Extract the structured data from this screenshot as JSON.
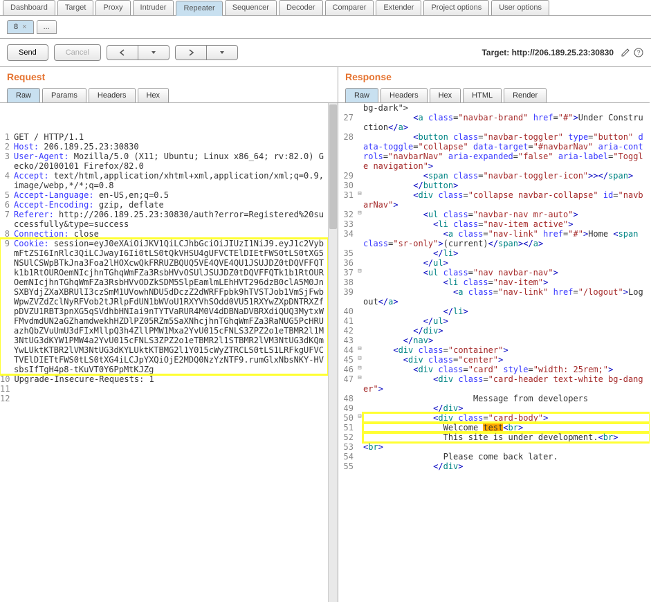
{
  "main_tabs": [
    {
      "label": "Dashboard",
      "active": false
    },
    {
      "label": "Target",
      "active": false
    },
    {
      "label": "Proxy",
      "active": false
    },
    {
      "label": "Intruder",
      "active": false
    },
    {
      "label": "Repeater",
      "active": true
    },
    {
      "label": "Sequencer",
      "active": false
    },
    {
      "label": "Decoder",
      "active": false
    },
    {
      "label": "Comparer",
      "active": false
    },
    {
      "label": "Extender",
      "active": false
    },
    {
      "label": "Project options",
      "active": false
    },
    {
      "label": "User options",
      "active": false
    }
  ],
  "sub_tabs": [
    {
      "label": "8",
      "active": true
    },
    {
      "label": "...",
      "active": false
    }
  ],
  "controls": {
    "send": "Send",
    "cancel": "Cancel",
    "target_label": "Target: http://206.189.25.23:30830"
  },
  "request": {
    "title": "Request",
    "view_tabs": [
      "Raw",
      "Params",
      "Headers",
      "Hex"
    ],
    "active_view": 0,
    "lines": [
      {
        "n": "1",
        "t": "GET / HTTP/1.1"
      },
      {
        "n": "2",
        "t": "Host",
        "v": " 206.189.25.23:30830"
      },
      {
        "n": "3",
        "t": "User-Agent",
        "v": " Mozilla/5.0 (X11; Ubuntu; Linux x86_64; rv:82.0) Gecko/20100101 Firefox/82.0"
      },
      {
        "n": "4",
        "t": "Accept",
        "v": " text/html,application/xhtml+xml,application/xml;q=0.9,image/webp,*/*;q=0.8"
      },
      {
        "n": "5",
        "t": "Accept-Language",
        "v": " en-US,en;q=0.5"
      },
      {
        "n": "6",
        "t": "Accept-Encoding",
        "v": " gzip, deflate"
      },
      {
        "n": "7",
        "t": "Referer",
        "v": " http://206.189.25.23:30830/auth?error=Registered%20successfully&type=success"
      },
      {
        "n": "8",
        "t": "Connection",
        "v": " close"
      },
      {
        "n": "9",
        "t": "Cookie",
        "v": " session=eyJ0eXAiOiJKV1QiLCJhbGciOiJIUzI1NiJ9.eyJ1c2VybmFtZSI6InRlc3QiLCJwayI6Ii0tLS0tQkVHSU4gUFVCTElDIEtFWS0tLS0tXG5NSUlCSWpBTkJna3Foa2lHOXcwQkFRRUZBQUQ5VE4QVE4QU1JSUJDZ0tDQVFFQTk1b1RtOUROemNIcjhnTGhqWmFZa3RsbHVvOSUlJSUJDZ0tDQVFFQTk1b1RtOUROemNIcjhnTGhqWmFZa3RsbHVvODZkSDM5SlpEamlmLEhHVT296dzB0clA5M0JnSXBYdjZXaXBRUlI3czSmM1UVowhNDU5dDczZ2dWRFFpbk9hTVSTJob1VmSjFwbWpwZVZdZclNyRFVob2tJRlpFdUN1bWVoU1RXYVhSOdd0VU51RXYwZXpDNTRXZfpDVZU1RBT3pnXG5qSVdhbHNIai9nTYTVaRUR4M0V4dDBNaDVBRXdiQUQ3MytxWFMvdmdUN2aGZhamdwekhHZDlPZ05RZm5SaXNhcjhnTGhqWmFZa3RaNUG5PcHRUazhQbZVuUmU3dFIxMllpQ3h4ZllPMW1Mxa2YvU015cFNLS3ZPZ2o1eTBMR2l1M3NtUG3dKYW1PMW4a2YvU015cFNLS3ZPZ2o1eTBMR2l1STBMR2lVM3NtUG3dKQmYwLUktKTBR2lVM3NtUG3dKYLUktKTBMG2l1Y015cWyZTRCLS0tLS1LRFkgUFVCTVElDIETtFWS0tLS0tXG4iLCJpYXQiOjE2MDQ0NzYzNTF9.rumGlxNbsNKY-HVsbsIfTgH4p8-tKuVT0Y6PpMtKJZg",
        "hl": true
      },
      {
        "n": "10",
        "t": "Upgrade-Insecure-Requests: 1"
      },
      {
        "n": "11",
        "t": ""
      },
      {
        "n": "12",
        "t": ""
      }
    ]
  },
  "response": {
    "title": "Response",
    "view_tabs": [
      "Raw",
      "Headers",
      "Hex",
      "HTML",
      "Render"
    ],
    "active_view": 0,
    "lines": [
      {
        "n": "",
        "f": "",
        "raw": "bg-dark\">"
      },
      {
        "n": "27",
        "f": "",
        "pre": "          ",
        "tag": "a",
        "attrs": [
          [
            "class",
            "navbar-brand"
          ],
          [
            "href",
            "#"
          ]
        ],
        "text": "Under Construction",
        "close": "a"
      },
      {
        "n": "28",
        "f": "",
        "pre": "          ",
        "tag": "button",
        "attrs": [
          [
            "class",
            "navbar-toggler"
          ],
          [
            "type",
            "button"
          ],
          [
            "data-toggle",
            "collapse"
          ],
          [
            "data-target",
            "#navbarNav"
          ],
          [
            "aria-controls",
            "navbarNav"
          ],
          [
            "aria-expanded",
            "false"
          ],
          [
            "aria-label",
            "Toggle navigation"
          ]
        ]
      },
      {
        "n": "29",
        "f": "",
        "pre": "            ",
        "tag": "span",
        "attrs": [
          [
            "class",
            "navbar-toggler-icon"
          ]
        ],
        "selftext": "></",
        "close": "span"
      },
      {
        "n": "30",
        "f": "",
        "pre": "          ",
        "closeonly": "button"
      },
      {
        "n": "31",
        "f": "⊟",
        "pre": "          ",
        "tag": "div",
        "attrs": [
          [
            "class",
            "collapse navbar-collapse"
          ],
          [
            "id",
            "navbarNav"
          ]
        ]
      },
      {
        "n": "32",
        "f": "⊟",
        "pre": "            ",
        "tag": "ul",
        "attrs": [
          [
            "class",
            "navbar-nav mr-auto"
          ]
        ]
      },
      {
        "n": "33",
        "f": "",
        "pre": "              ",
        "tag": "li",
        "attrs": [
          [
            "class",
            "nav-item active"
          ]
        ]
      },
      {
        "n": "34",
        "f": "",
        "pre": "                ",
        "tag": "a",
        "attrs": [
          [
            "class",
            "nav-link"
          ],
          [
            "href",
            "#"
          ]
        ],
        "posttext": "Home ",
        "inline_span": {
          "tag": "span",
          "attrs": [
            [
              "class",
              "sr-only"
            ]
          ],
          "text": "(current)"
        },
        "close_trail": [
          "a"
        ]
      },
      {
        "n": "35",
        "f": "",
        "pre": "              ",
        "closeonly": "li"
      },
      {
        "n": "36",
        "f": "",
        "pre": "            ",
        "closeonly": "ul"
      },
      {
        "n": "37",
        "f": "⊟",
        "pre": "            ",
        "tag": "ul",
        "attrs": [
          [
            "class",
            "nav navbar-nav"
          ]
        ]
      },
      {
        "n": "38",
        "f": "",
        "pre": "                ",
        "tag": "li",
        "attrs": [
          [
            "class",
            "nav-item"
          ]
        ]
      },
      {
        "n": "39",
        "f": "",
        "pre": "                  ",
        "tag": "a",
        "attrs": [
          [
            "class",
            "nav-link"
          ],
          [
            "href",
            "/logout"
          ]
        ],
        "text": "Logout",
        "close": "a"
      },
      {
        "n": "40",
        "f": "",
        "pre": "                ",
        "closeonly": "li"
      },
      {
        "n": "41",
        "f": "",
        "pre": "            ",
        "closeonly": "ul"
      },
      {
        "n": "42",
        "f": "",
        "pre": "          ",
        "closeonly": "div"
      },
      {
        "n": "43",
        "f": "",
        "pre": "        ",
        "closeonly": "nav"
      },
      {
        "n": "44",
        "f": "⊟",
        "pre": "      ",
        "tag": "div",
        "attrs": [
          [
            "class",
            "container"
          ]
        ]
      },
      {
        "n": "45",
        "f": "⊟",
        "pre": "        ",
        "tag": "div",
        "attrs": [
          [
            "class",
            "center"
          ]
        ]
      },
      {
        "n": "46",
        "f": "⊟",
        "pre": "          ",
        "tag": "div",
        "attrs": [
          [
            "class",
            "card"
          ],
          [
            "style",
            "width: 25rem;"
          ]
        ]
      },
      {
        "n": "47",
        "f": "⊟",
        "pre": "              ",
        "tag": "div",
        "attrs": [
          [
            "class",
            "card-header text-white bg-danger"
          ]
        ]
      },
      {
        "n": "48",
        "f": "",
        "pre": "                      ",
        "plaintext": "Message from developers"
      },
      {
        "n": "49",
        "f": "",
        "pre": "              ",
        "closeonly": "div"
      },
      {
        "n": "50",
        "f": "⊟",
        "pre": "              ",
        "tag": "div",
        "attrs": [
          [
            "class",
            "card-body"
          ]
        ],
        "hl_top": true
      },
      {
        "n": "51",
        "f": "",
        "pre": "                ",
        "plaintext_parts": [
          [
            "Welcome ",
            ""
          ],
          [
            "test",
            "hl"
          ],
          [
            "<",
            "darkblue"
          ],
          [
            "br",
            "teal"
          ],
          [
            ">",
            "darkblue"
          ]
        ],
        "boxed": true
      },
      {
        "n": "52",
        "f": "",
        "pre": "                ",
        "plaintext": "This site is under development.",
        "tail_br": true,
        "boxed": true
      },
      {
        "n": "53",
        "f": "",
        "pre": "",
        "plaintext_parts": [
          [
            "<",
            "darkblue"
          ],
          [
            "br",
            "teal"
          ],
          [
            ">",
            "darkblue"
          ]
        ]
      },
      {
        "n": "54",
        "f": "",
        "pre": "                ",
        "plaintext": "Please come back later."
      },
      {
        "n": "55",
        "f": "",
        "pre": "              ",
        "closeonly": "div"
      }
    ]
  }
}
